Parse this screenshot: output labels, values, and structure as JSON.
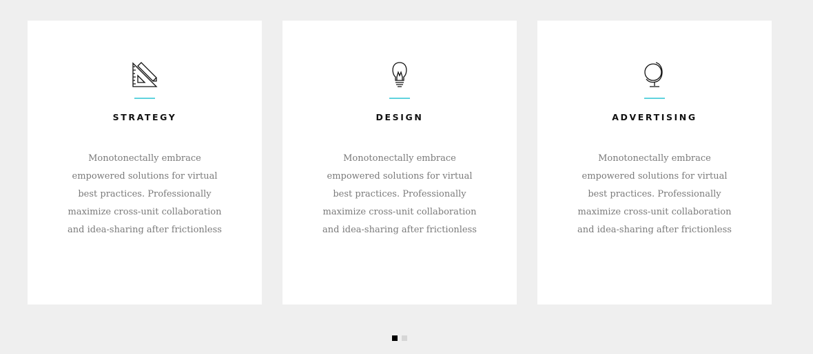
{
  "cards": [
    {
      "icon": "ruler-triangle-icon",
      "title": "Strategy",
      "text": "Monotonectally embrace empowered solutions for virtual best practices. Professionally maximize cross-unit collaboration and idea-sharing after frictionless"
    },
    {
      "icon": "lightbulb-icon",
      "title": "Design",
      "text": "Monotonectally embrace empowered solutions for virtual best practices. Professionally maximize cross-unit collaboration and idea-sharing after frictionless"
    },
    {
      "icon": "globe-icon",
      "title": "Advertising",
      "text": "Monotonectally embrace empowered solutions for virtual best practices. Professionally maximize cross-unit collaboration and idea-sharing after frictionless"
    }
  ],
  "pager": {
    "total": 2,
    "active_index": 0
  },
  "colors": {
    "background": "#efefef",
    "card": "#ffffff",
    "accent": "#5fd3de",
    "title": "#111111",
    "body_text": "#7a7a7a",
    "dot_active": "#000000",
    "dot_inactive": "#d6d6d6"
  }
}
